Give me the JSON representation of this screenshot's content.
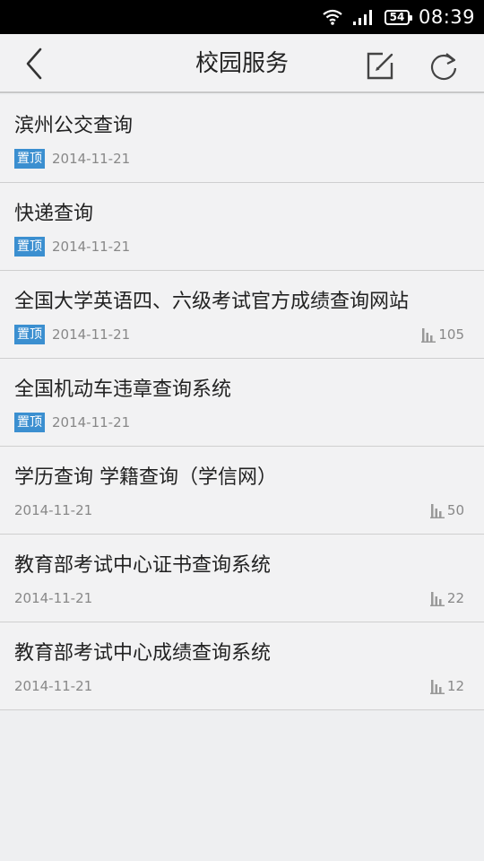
{
  "status_bar": {
    "battery": "54",
    "time": "08:39"
  },
  "header": {
    "title": "校园服务"
  },
  "items": [
    {
      "title": "滨州公交查询",
      "pinned": true,
      "pin_label": "置顶",
      "date": "2014-11-21",
      "views": ""
    },
    {
      "title": "快递查询",
      "pinned": true,
      "pin_label": "置顶",
      "date": "2014-11-21",
      "views": ""
    },
    {
      "title": "全国大学英语四、六级考试官方成绩查询网站",
      "pinned": true,
      "pin_label": "置顶",
      "date": "2014-11-21",
      "views": "105"
    },
    {
      "title": "全国机动车违章查询系统",
      "pinned": true,
      "pin_label": "置顶",
      "date": "2014-11-21",
      "views": ""
    },
    {
      "title": "学历查询 学籍查询（学信网）",
      "pinned": false,
      "pin_label": "",
      "date": "2014-11-21",
      "views": "50"
    },
    {
      "title": "教育部考试中心证书查询系统",
      "pinned": false,
      "pin_label": "",
      "date": "2014-11-21",
      "views": "22"
    },
    {
      "title": "教育部考试中心成绩查询系统",
      "pinned": false,
      "pin_label": "",
      "date": "2014-11-21",
      "views": "12"
    }
  ],
  "colors": {
    "accent": "#3b8fd0",
    "background": "#eeeff1",
    "status_bar": "#000000"
  },
  "icons": [
    "wifi-icon",
    "signal-icon",
    "battery-icon",
    "back-arrow-icon",
    "edit-icon",
    "refresh-icon",
    "bar-chart-icon"
  ]
}
